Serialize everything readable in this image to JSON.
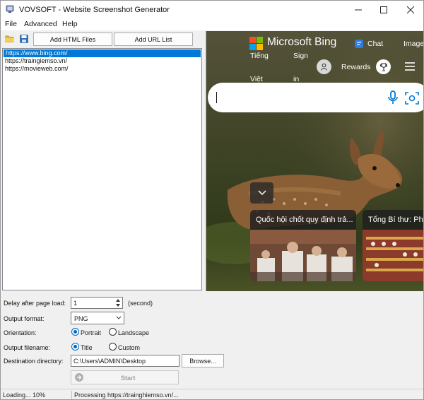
{
  "window": {
    "title": "VOVSOFT - Website Screenshot Generator"
  },
  "menu": {
    "file": "File",
    "advanced": "Advanced",
    "help": "Help"
  },
  "toolbar": {
    "add_html_files": "Add HTML Files",
    "add_url_list": "Add URL List"
  },
  "url_list": {
    "items": [
      "https://www.bing.com/",
      "https://traingiemso.vn/",
      "https://movieweb.com/"
    ],
    "selected_index": 0
  },
  "preview": {
    "brand": "Microsoft Bing",
    "nav_chat": "Chat",
    "nav_images": "Image",
    "nav_lang_1": "Tiếng",
    "nav_lang_2": "Việt",
    "nav_sign_1": "Sign",
    "nav_sign_2": "in",
    "nav_rewards": "Rewards",
    "news": [
      {
        "caption": "Quốc hội chốt quy định trả..."
      },
      {
        "caption": "Tổng Bí thư: Phải"
      }
    ]
  },
  "settings": {
    "delay_label": "Delay after page load:",
    "delay_value": "1",
    "delay_unit": "(second)",
    "format_label": "Output format:",
    "format_value": "PNG",
    "orientation_label": "Orientation:",
    "orientation_portrait": "Portrait",
    "orientation_landscape": "Landscape",
    "orientation_selected": "Portrait",
    "filename_label": "Output filename:",
    "filename_title": "Title",
    "filename_custom": "Custom",
    "filename_selected": "Title",
    "dest_label": "Destination directory:",
    "dest_value": "C:\\Users\\ADMIN\\Desktop",
    "browse_label": "Browse...",
    "start_label": "Start"
  },
  "status": {
    "progress_text": "Loading... 10%",
    "message": "Processing https://trainghiemso.vn/..."
  },
  "colors": {
    "selection": "#0078d7",
    "radio_accent": "#0067c0",
    "bing_blue": "#0078d4"
  }
}
